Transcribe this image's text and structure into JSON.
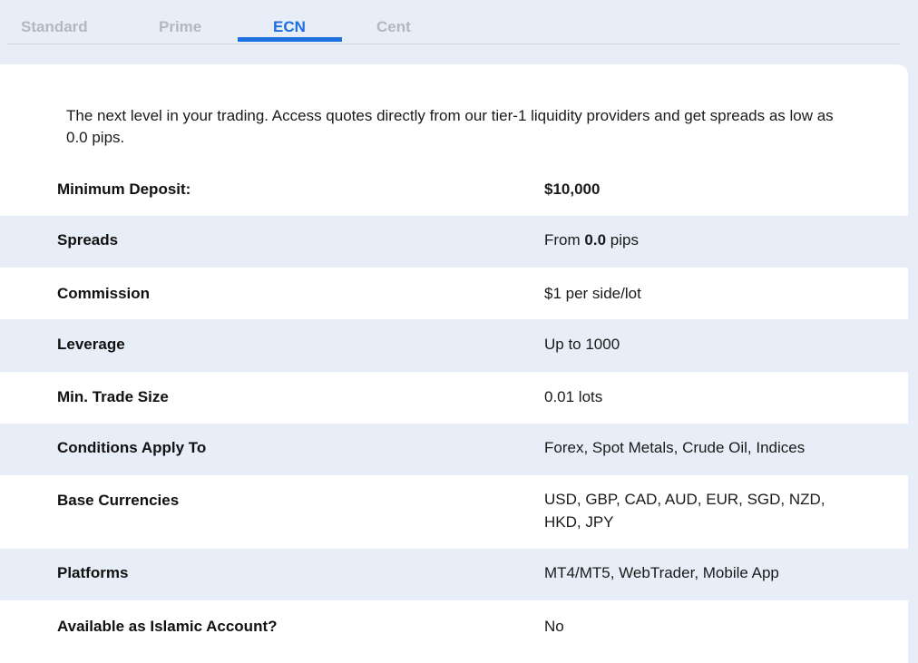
{
  "tabs": [
    {
      "label": "Standard"
    },
    {
      "label": "Prime"
    },
    {
      "label": "ECN"
    },
    {
      "label": "Cent"
    }
  ],
  "active_tab": "ECN",
  "intro": "The next level in your trading. Access quotes directly from our tier-1 liquidity providers and get spreads as low as 0.0 pips.",
  "rows": [
    {
      "label": "Minimum Deposit:",
      "value": "$10,000"
    },
    {
      "label": "Spreads",
      "value_prefix": "From ",
      "value_bold": "0.0",
      "value_suffix": " pips"
    },
    {
      "label": "Commission",
      "value": "$1 per side/lot"
    },
    {
      "label": "Leverage",
      "value": "Up to 1000"
    },
    {
      "label": "Min. Trade Size",
      "value": "0.01 lots"
    },
    {
      "label": "Conditions Apply To",
      "value": "Forex, Spot Metals, Crude Oil, Indices"
    },
    {
      "label": "Base Currencies",
      "value": "USD, GBP, CAD, AUD, EUR, SGD, NZD, HKD, JPY"
    },
    {
      "label": "Platforms",
      "value": "MT4/MT5, WebTrader, Mobile App"
    },
    {
      "label": "Available as Islamic Account?",
      "value": "No"
    }
  ],
  "colors": {
    "accent": "#1e6fe0",
    "shade": "#e8eef8",
    "inactive_tab": "#b3b8c0"
  }
}
